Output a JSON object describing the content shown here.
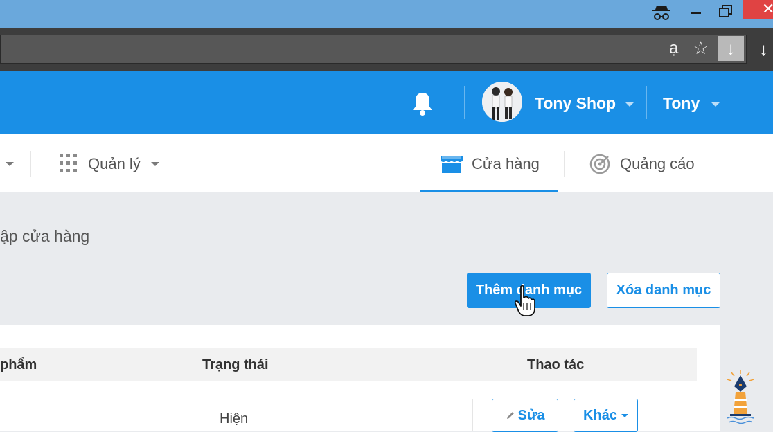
{
  "browser": {
    "window_buttons": {
      "close": "✕"
    },
    "toolbar": {
      "translate_glyph": "ạ",
      "star_glyph": "☆",
      "download_glyph": "↓"
    }
  },
  "header": {
    "shop_name": "Tony Shop",
    "user_name": "Tony",
    "brand_color": "#1a8fe6"
  },
  "nav": {
    "manage_label": "Quản lý",
    "store_tab": "Cửa hàng",
    "ads_tab": "Quảng cáo"
  },
  "content": {
    "breadcrumb": "ập cửa hàng",
    "add_category_button": "Thêm danh mục",
    "delete_category_button": "Xóa danh mục"
  },
  "table": {
    "columns": [
      "phẩm",
      "Trạng thái",
      "Thao tác"
    ],
    "rows": [
      {
        "status": "Hiện",
        "edit_label": "Sửa",
        "more_label": "Khác"
      }
    ]
  },
  "icons": {
    "incognito": "incognito-icon",
    "bell": "bell-icon",
    "grid": "grid-icon",
    "store": "store-icon",
    "ads": "target-icon",
    "pencil": "pencil-icon",
    "cursor": "hand-cursor-icon"
  }
}
